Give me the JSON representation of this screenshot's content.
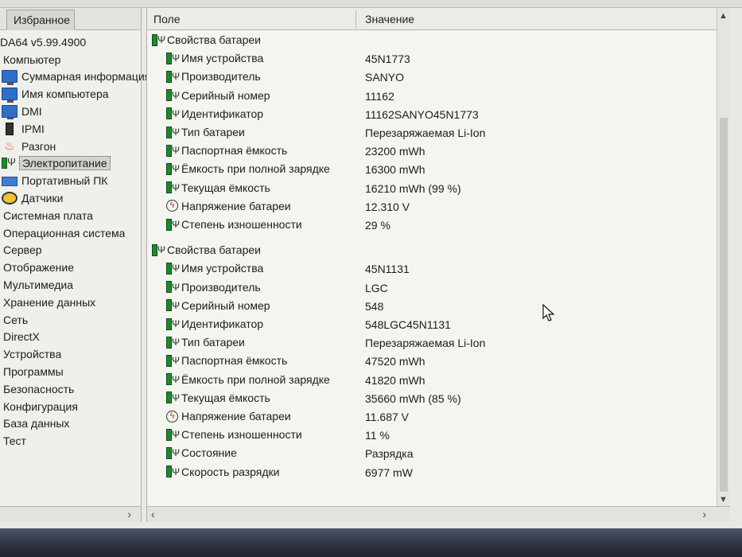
{
  "left_panel": {
    "tab_favorites": "Избранное",
    "app_version": "DA64 v5.99.4900",
    "scroll_right_arrow": "›",
    "tree": [
      {
        "label": "Компьютер",
        "icon": "none"
      },
      {
        "label": "Суммарная информация",
        "icon": "monitor-icon"
      },
      {
        "label": "Имя компьютера",
        "icon": "monitor-icon"
      },
      {
        "label": "DMI",
        "icon": "monitor-icon"
      },
      {
        "label": "IPMI",
        "icon": "ipmi-icon"
      },
      {
        "label": "Разгон",
        "icon": "fire-icon"
      },
      {
        "label": "Электропитание",
        "icon": "battery-icon",
        "selected": true
      },
      {
        "label": "Портативный ПК",
        "icon": "laptop-icon"
      },
      {
        "label": "Датчики",
        "icon": "gauge-icon"
      },
      {
        "label": "Системная плата",
        "icon": "none"
      },
      {
        "label": "Операционная система",
        "icon": "none"
      },
      {
        "label": "Сервер",
        "icon": "none"
      },
      {
        "label": "Отображение",
        "icon": "none"
      },
      {
        "label": "Мультимедиа",
        "icon": "none"
      },
      {
        "label": "Хранение данных",
        "icon": "none"
      },
      {
        "label": "Сеть",
        "icon": "none"
      },
      {
        "label": "DirectX",
        "icon": "none"
      },
      {
        "label": "Устройства",
        "icon": "none"
      },
      {
        "label": "Программы",
        "icon": "none"
      },
      {
        "label": "Безопасность",
        "icon": "none"
      },
      {
        "label": "Конфигурация",
        "icon": "none"
      },
      {
        "label": "База данных",
        "icon": "none"
      },
      {
        "label": "Тест",
        "icon": "none"
      }
    ]
  },
  "table": {
    "col_field": "Поле",
    "col_value": "Значение",
    "scroll_up": "▲",
    "scroll_down": "▼",
    "scroll_left": "‹",
    "scroll_right": "›",
    "groups": [
      {
        "title": "Свойства батареи",
        "rows": [
          {
            "field": "Имя устройства",
            "value": "45N1773",
            "icon": "battery-icon"
          },
          {
            "field": "Производитель",
            "value": "SANYO",
            "icon": "battery-icon"
          },
          {
            "field": "Серийный номер",
            "value": "11162",
            "icon": "battery-icon"
          },
          {
            "field": "Идентификатор",
            "value": "11162SANYO45N1773",
            "icon": "battery-icon"
          },
          {
            "field": "Тип батареи",
            "value": "Перезаряжаемая Li-Ion",
            "icon": "battery-icon"
          },
          {
            "field": "Паспортная ёмкость",
            "value": "23200 mWh",
            "icon": "battery-icon"
          },
          {
            "field": "Ёмкость при полной зарядке",
            "value": "16300 mWh",
            "icon": "battery-icon"
          },
          {
            "field": "Текущая ёмкость",
            "value": "16210 mWh  (99 %)",
            "icon": "battery-icon"
          },
          {
            "field": "Напряжение батареи",
            "value": "12.310 V",
            "icon": "voltage-icon"
          },
          {
            "field": "Степень изношенности",
            "value": "29 %",
            "icon": "battery-icon"
          }
        ]
      },
      {
        "title": "Свойства батареи",
        "rows": [
          {
            "field": "Имя устройства",
            "value": "45N1131",
            "icon": "battery-icon"
          },
          {
            "field": "Производитель",
            "value": "LGC",
            "icon": "battery-icon"
          },
          {
            "field": "Серийный номер",
            "value": "548",
            "icon": "battery-icon"
          },
          {
            "field": "Идентификатор",
            "value": "548LGC45N1131",
            "icon": "battery-icon"
          },
          {
            "field": "Тип батареи",
            "value": "Перезаряжаемая Li-Ion",
            "icon": "battery-icon"
          },
          {
            "field": "Паспортная ёмкость",
            "value": "47520 mWh",
            "icon": "battery-icon"
          },
          {
            "field": "Ёмкость при полной зарядке",
            "value": "41820 mWh",
            "icon": "battery-icon"
          },
          {
            "field": "Текущая ёмкость",
            "value": "35660 mWh  (85 %)",
            "icon": "battery-icon"
          },
          {
            "field": "Напряжение батареи",
            "value": "11.687 V",
            "icon": "voltage-icon"
          },
          {
            "field": "Степень изношенности",
            "value": "11 %",
            "icon": "battery-icon"
          },
          {
            "field": "Состояние",
            "value": "Разрядка",
            "icon": "battery-icon"
          },
          {
            "field": "Скорость разрядки",
            "value": "6977 mW",
            "icon": "battery-icon"
          }
        ]
      }
    ]
  }
}
